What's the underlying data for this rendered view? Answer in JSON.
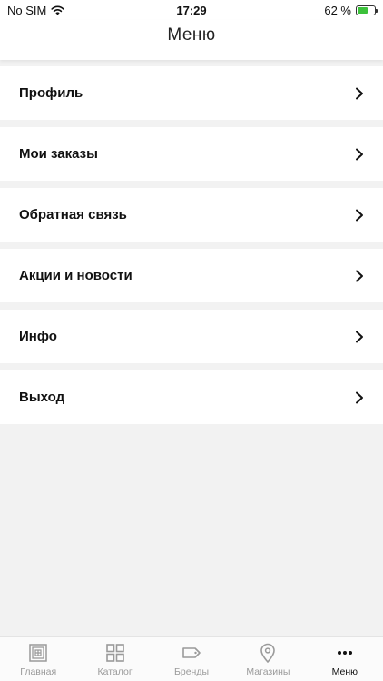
{
  "status_bar": {
    "carrier": "No SIM",
    "time": "17:29",
    "battery_text": "62 %",
    "battery_level": 0.62
  },
  "header": {
    "title": "Меню"
  },
  "menu": {
    "items": [
      {
        "label": "Профиль"
      },
      {
        "label": "Мои заказы"
      },
      {
        "label": "Обратная связь"
      },
      {
        "label": "Акции и новости"
      },
      {
        "label": "Инфо"
      },
      {
        "label": "Выход"
      }
    ]
  },
  "tabbar": {
    "tabs": [
      {
        "label": "Главная",
        "icon": "home-icon"
      },
      {
        "label": "Каталог",
        "icon": "catalog-icon"
      },
      {
        "label": "Бренды",
        "icon": "tag-icon"
      },
      {
        "label": "Магазины",
        "icon": "map-pin-icon"
      },
      {
        "label": "Меню",
        "icon": "more-dots-icon"
      }
    ],
    "active_index": 4
  },
  "colors": {
    "background": "#f2f2f2",
    "battery_green": "#3cc13b",
    "inactive_tab": "#9a9a9a"
  }
}
